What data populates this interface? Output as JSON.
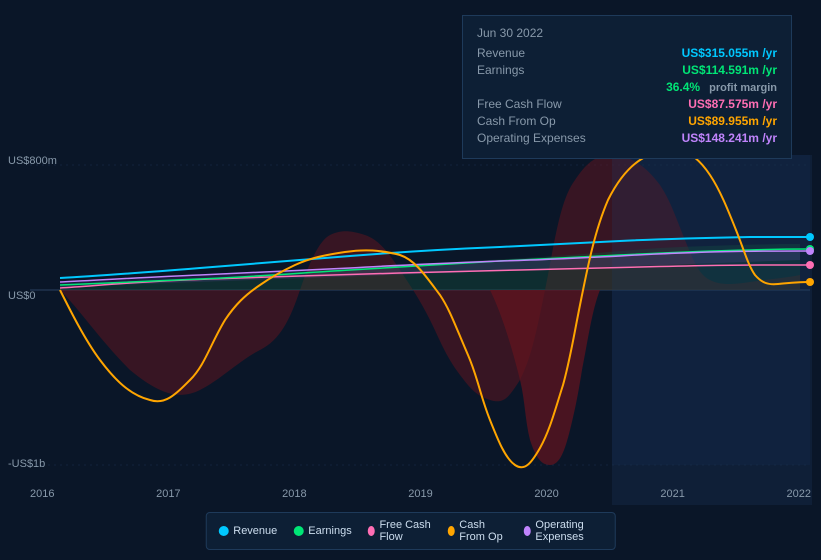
{
  "chart": {
    "title": "Jun 30 2022",
    "y_labels": {
      "top": "US$800m",
      "zero": "US$0",
      "bottom": "-US$1b"
    },
    "x_labels": [
      "2016",
      "2017",
      "2018",
      "2019",
      "2020",
      "2021",
      "2022"
    ],
    "tooltip": {
      "date": "Jun 30 2022",
      "rows": [
        {
          "label": "Revenue",
          "value": "US$315.055m",
          "suffix": "/yr",
          "color": "cyan"
        },
        {
          "label": "Earnings",
          "value": "US$114.591m",
          "suffix": "/yr",
          "color": "green",
          "sub": "36.4% profit margin"
        },
        {
          "label": "Free Cash Flow",
          "value": "US$87.575m",
          "suffix": "/yr",
          "color": "pink"
        },
        {
          "label": "Cash From Op",
          "value": "US$89.955m",
          "suffix": "/yr",
          "color": "orange"
        },
        {
          "label": "Operating Expenses",
          "value": "US$148.241m",
          "suffix": "/yr",
          "color": "purple"
        }
      ]
    },
    "legend": [
      {
        "label": "Revenue",
        "color": "#00c8ff"
      },
      {
        "label": "Earnings",
        "color": "#00e676"
      },
      {
        "label": "Free Cash Flow",
        "color": "#ff6eb4"
      },
      {
        "label": "Cash From Op",
        "color": "#ffa500"
      },
      {
        "label": "Operating Expenses",
        "color": "#c084fc"
      }
    ]
  }
}
